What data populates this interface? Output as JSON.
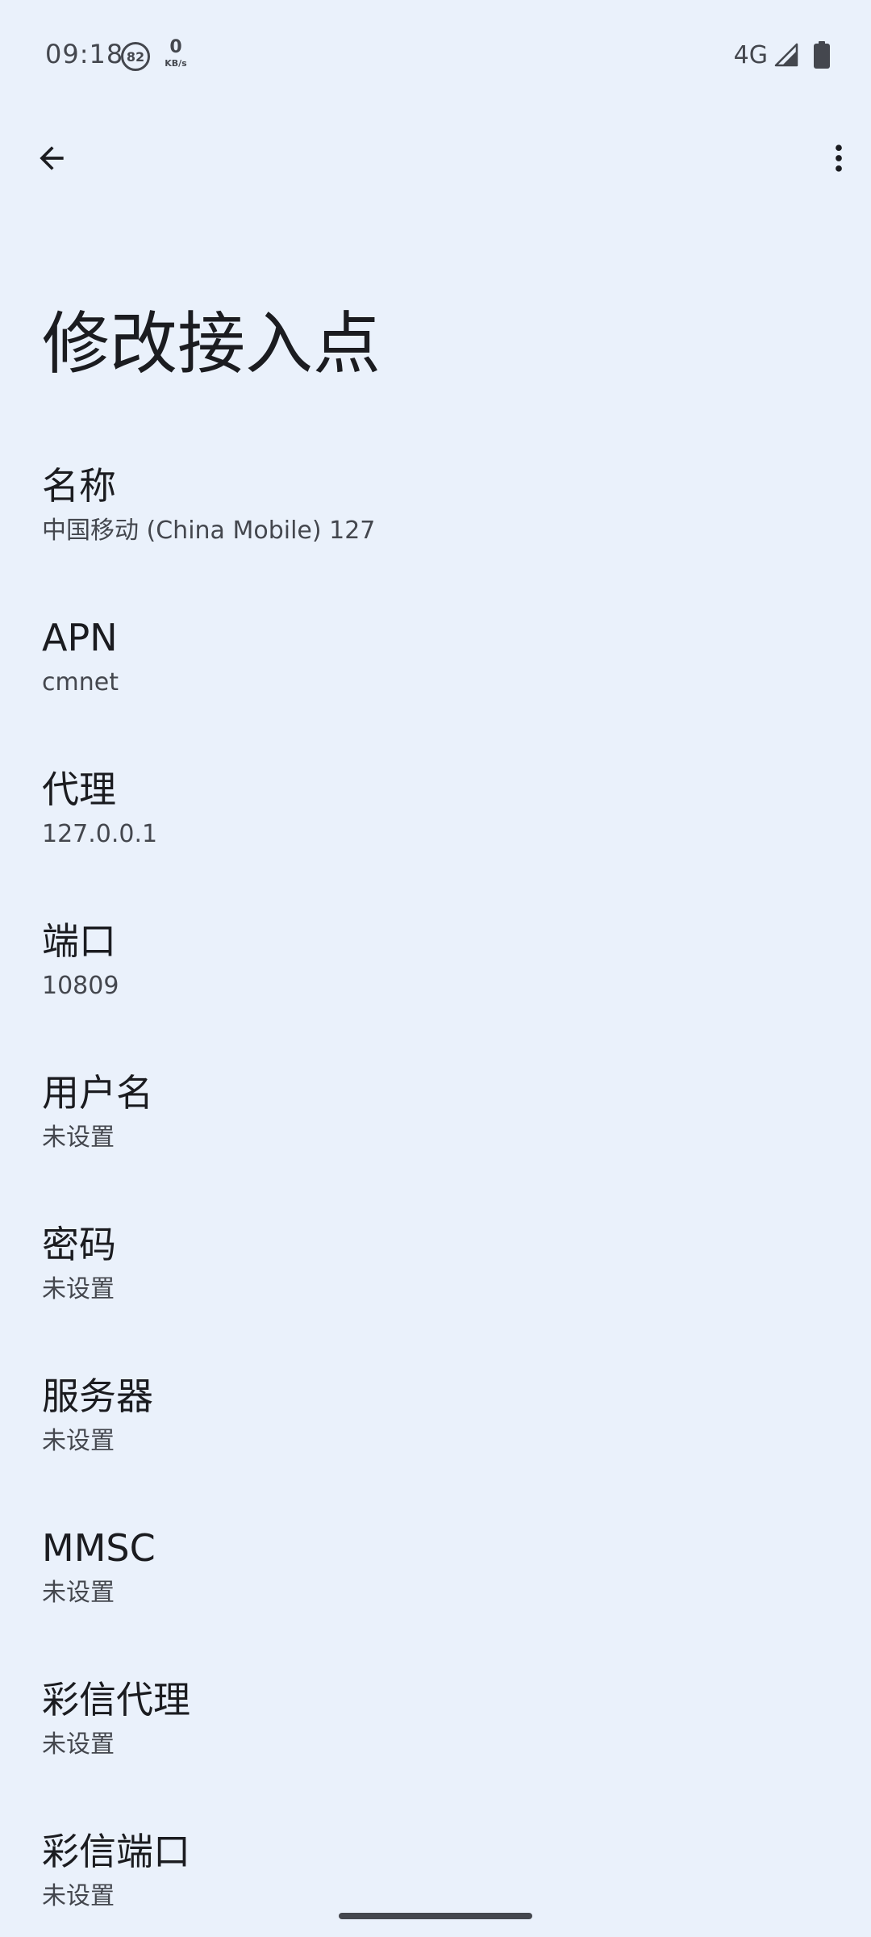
{
  "status_bar": {
    "time": "09:18",
    "notification_count": "82",
    "net_speed_value": "0",
    "net_speed_unit": "KB/s",
    "network_type": "4G"
  },
  "app_bar": {
    "back_icon": "arrow-back-icon",
    "more_icon": "more-vert-icon"
  },
  "page": {
    "title": "修改接入点"
  },
  "preferences": [
    {
      "title": "名称",
      "summary": "中国移动 (China Mobile) 127"
    },
    {
      "title": "APN",
      "summary": "cmnet"
    },
    {
      "title": "代理",
      "summary": "127.0.0.1"
    },
    {
      "title": "端口",
      "summary": "10809"
    },
    {
      "title": "用户名",
      "summary": "未设置"
    },
    {
      "title": "密码",
      "summary": "未设置"
    },
    {
      "title": "服务器",
      "summary": "未设置"
    },
    {
      "title": "MMSC",
      "summary": "未设置"
    },
    {
      "title": "彩信代理",
      "summary": "未设置"
    },
    {
      "title": "彩信端口",
      "summary": "未设置"
    }
  ],
  "colors": {
    "background": "#EAF1FB",
    "text_primary": "#1B1C20",
    "text_secondary": "#44474E"
  }
}
